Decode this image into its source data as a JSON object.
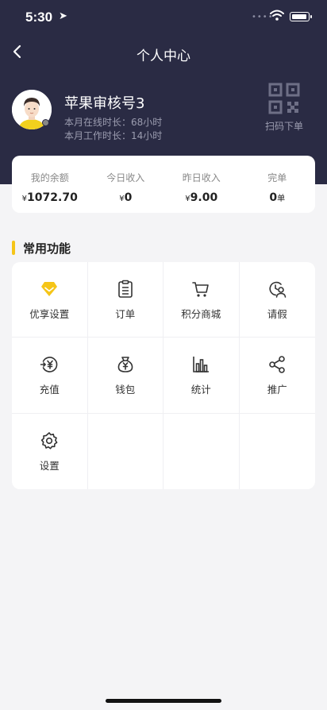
{
  "status_bar": {
    "time": "5:30"
  },
  "nav": {
    "title": "个人中心"
  },
  "profile": {
    "name": "苹果审核号3",
    "online_label": "本月在线时长：",
    "online_value": "68小时",
    "work_label": "本月工作时长：",
    "work_value": "14小时"
  },
  "scan": {
    "label": "扫码下单"
  },
  "stats": [
    {
      "title": "我的余额",
      "currency": "¥",
      "value": "1072.70"
    },
    {
      "title": "今日收入",
      "currency": "¥",
      "value": "0"
    },
    {
      "title": "昨日收入",
      "currency": "¥",
      "value": "9.00"
    },
    {
      "title": "完单",
      "value": "0",
      "unit": "单"
    }
  ],
  "functions": {
    "title": "常用功能",
    "items": [
      {
        "label": "优享设置",
        "icon": "diamond-icon"
      },
      {
        "label": "订单",
        "icon": "clipboard-icon"
      },
      {
        "label": "积分商城",
        "icon": "cart-icon"
      },
      {
        "label": "请假",
        "icon": "leave-icon"
      },
      {
        "label": "充值",
        "icon": "recharge-icon"
      },
      {
        "label": "钱包",
        "icon": "wallet-icon"
      },
      {
        "label": "统计",
        "icon": "chart-icon"
      },
      {
        "label": "推广",
        "icon": "share-icon"
      },
      {
        "label": "设置",
        "icon": "gear-icon"
      }
    ]
  },
  "colors": {
    "header": "#2a2b44",
    "accent": "#f5c518",
    "background": "#f4f4f6"
  }
}
